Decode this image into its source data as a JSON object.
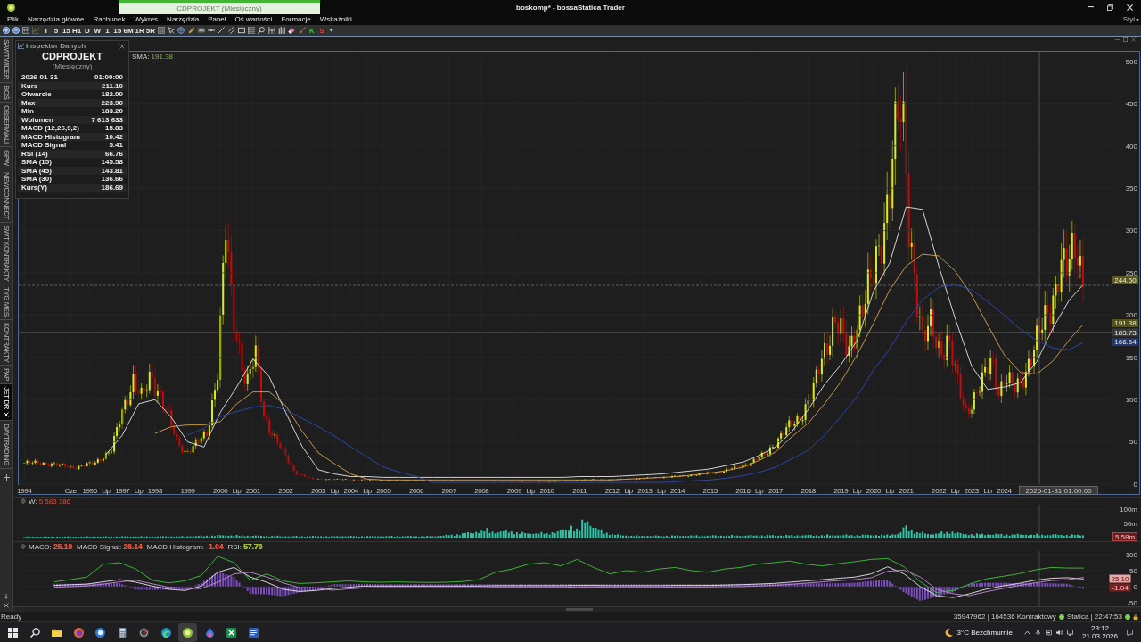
{
  "window": {
    "title": "boskomp* - bossaStatica Trader",
    "document_tab": "CDPROJEKT (Miesięczny)",
    "style_menu": "Styl"
  },
  "menu": [
    "Plik",
    "Narzędzia główne",
    "Rachunek",
    "Wykres",
    "Narzędzia",
    "Panel",
    "Oś wartości",
    "Formacje",
    "Wskaźniki"
  ],
  "toolbar": {
    "intervals": [
      "T",
      "5",
      "15",
      "H1",
      "D",
      "W",
      "1",
      "15",
      "6M",
      "1R",
      "5R"
    ],
    "k_button": "K",
    "s_button": "S"
  },
  "side_tabs": [
    {
      "label": "SAWTWIDER",
      "selected": false
    },
    {
      "label": "BOŚ",
      "selected": false
    },
    {
      "label": "OBSERWALI",
      "selected": false
    },
    {
      "label": "GPW",
      "selected": false
    },
    {
      "label": "NEWCONNECT",
      "selected": false
    },
    {
      "label": "SWT KONTRAKTY",
      "selected": false
    },
    {
      "label": "TYG MES",
      "selected": false
    },
    {
      "label": "KONTRAKTY",
      "selected": false
    },
    {
      "label": "PAP",
      "selected": false
    },
    {
      "label": "JET DR",
      "selected": true
    },
    {
      "label": "DAYTRADING",
      "selected": false
    }
  ],
  "inspector": {
    "title": "Inspektor Danych",
    "symbol": "CDPROJEKT",
    "interval": "(Miesięczny)",
    "rows": [
      {
        "label": "2026-01-31",
        "value": "01:00:00"
      },
      {
        "label": "Kurs",
        "value": "211.10"
      },
      {
        "label": "Otwarcie",
        "value": "182.00"
      },
      {
        "label": "Max",
        "value": "223.90"
      },
      {
        "label": "Min",
        "value": "183.20"
      },
      {
        "label": "Wolumen",
        "value": "7 613 633"
      },
      {
        "label": "MACD (12,26,9,2)",
        "value": "15.83"
      },
      {
        "label": "MACD Histogram",
        "value": "10.42"
      },
      {
        "label": "MACD Signal",
        "value": "5.41"
      },
      {
        "label": "RSI (14)",
        "value": "66.76"
      },
      {
        "label": "SMA (15)",
        "value": "145.58"
      },
      {
        "label": "SMA (45)",
        "value": "143.81"
      },
      {
        "label": "SMA (30)",
        "value": "136.66"
      },
      {
        "label": "Kurs(Y)",
        "value": "186.69"
      }
    ]
  },
  "price_chart": {
    "legend": {
      "label": "SMA:",
      "value": "191.38"
    },
    "crosshair_date": "2025-01-31 01:00:00",
    "markers": [
      {
        "text": "244.50",
        "color": "#5c5a1e"
      },
      {
        "text": "191.38",
        "color": "#55531c"
      },
      {
        "text": "183.73",
        "color": "#3a3a3a"
      },
      {
        "text": "166.54",
        "color": "#23366e"
      }
    ],
    "chart_data": {
      "type": "line",
      "grid": true,
      "x": [
        1996.5,
        1997,
        1997.5,
        1998,
        1998.5,
        1999,
        1999.5,
        2000,
        2000.5,
        2001,
        2001.5,
        2002,
        2002.5,
        2003,
        2003.5,
        2004,
        2004.5,
        2005,
        2005.5,
        2006,
        2006.5,
        2007,
        2007.5,
        2008,
        2008.5,
        2009,
        2009.5,
        2010,
        2010.5,
        2011,
        2011.5,
        2012,
        2012.5,
        2013,
        2013.5,
        2014,
        2014.5,
        2015,
        2015.5,
        2016,
        2016.5,
        2017,
        2017.5,
        2018,
        2018.5,
        2019,
        2019.5,
        2020,
        2020.5,
        2021,
        2021.5,
        2022,
        2022.5,
        2023,
        2023.5,
        2024,
        2024.5,
        2025,
        2025.5,
        2026,
        2026.4
      ],
      "series": [
        {
          "color": "#e6e6e6",
          "values": [
            35,
            58,
            95,
            100,
            79,
            50,
            44,
            85,
            115,
            148,
            127,
            85,
            45,
            17,
            12,
            9,
            9,
            8,
            8,
            8,
            8,
            8,
            8,
            8,
            8,
            8,
            8,
            8,
            8,
            9,
            9,
            9,
            10,
            11,
            12,
            14,
            16,
            18,
            22,
            26,
            34,
            44,
            62,
            88,
            118,
            141,
            170,
            228,
            262,
            328,
            325,
            258,
            196,
            140,
            112,
            115,
            120,
            145,
            185,
            218,
            235
          ]
        },
        {
          "color": "#d6a44c",
          "values": [
            null,
            null,
            null,
            60,
            68,
            70,
            70,
            74,
            95,
            109,
            109,
            93,
            63,
            37,
            24,
            12,
            6,
            5,
            5,
            5,
            5,
            5,
            5,
            5,
            5,
            5,
            5,
            5,
            5,
            5,
            5,
            5,
            6,
            7,
            8,
            9,
            11,
            13,
            16,
            20,
            28,
            38,
            56,
            72,
            95,
            121,
            153,
            190,
            230,
            258,
            272,
            270,
            252,
            224,
            188,
            153,
            132,
            130,
            146,
            171,
            188
          ]
        },
        {
          "color": "#2d4bb8",
          "values": [
            null,
            null,
            null,
            null,
            null,
            58,
            66,
            80,
            86,
            91,
            93,
            88,
            78,
            68,
            57,
            44,
            32,
            20,
            14,
            9,
            2,
            2,
            2,
            2,
            2,
            2,
            2,
            2,
            2,
            2,
            2,
            2,
            2,
            2,
            2,
            3,
            4,
            5,
            7,
            10,
            14,
            20,
            30,
            40,
            58,
            80,
            104,
            135,
            160,
            192,
            218,
            233,
            236,
            230,
            216,
            200,
            183,
            170,
            161,
            159,
            167
          ]
        }
      ],
      "xlim": [
        1993.8,
        2027.29
      ],
      "ylim": [
        0,
        512
      ],
      "xticks": [
        {
          "value": 1994,
          "label": "1994"
        },
        {
          "value": 1995.42,
          "label": "Cze"
        },
        {
          "value": 1996,
          "label": "1996"
        },
        {
          "value": 1996.5,
          "label": "Lip"
        },
        {
          "value": 1997,
          "label": "1997"
        },
        {
          "value": 1997.5,
          "label": "Lip"
        },
        {
          "value": 1998,
          "label": "1998"
        },
        {
          "value": 1999,
          "label": "1999"
        },
        {
          "value": 2000,
          "label": "2000"
        },
        {
          "value": 2000.5,
          "label": "Lip"
        },
        {
          "value": 2001,
          "label": "2001"
        },
        {
          "value": 2002,
          "label": "2002"
        },
        {
          "value": 2003,
          "label": "2003"
        },
        {
          "value": 2003.5,
          "label": "Lip"
        },
        {
          "value": 2004,
          "label": "2004"
        },
        {
          "value": 2004.5,
          "label": "Lip"
        },
        {
          "value": 2005,
          "label": "2005"
        },
        {
          "value": 2006,
          "label": "2006"
        },
        {
          "value": 2007,
          "label": "2007"
        },
        {
          "value": 2008,
          "label": "2008"
        },
        {
          "value": 2009,
          "label": "2009"
        },
        {
          "value": 2009.5,
          "label": "Lip"
        },
        {
          "value": 2010,
          "label": "2010"
        },
        {
          "value": 2011,
          "label": "2011"
        },
        {
          "value": 2012,
          "label": "2012"
        },
        {
          "value": 2012.5,
          "label": "Lip"
        },
        {
          "value": 2013,
          "label": "2013"
        },
        {
          "value": 2013.5,
          "label": "Lip"
        },
        {
          "value": 2014,
          "label": "2014"
        },
        {
          "value": 2015,
          "label": "2015"
        },
        {
          "value": 2016,
          "label": "2016"
        },
        {
          "value": 2016.5,
          "label": "Lip"
        },
        {
          "value": 2017,
          "label": "2017"
        },
        {
          "value": 2018,
          "label": "2018"
        },
        {
          "value": 2019,
          "label": "2019"
        },
        {
          "value": 2019.5,
          "label": "Lip"
        },
        {
          "value": 2020,
          "label": "2020"
        },
        {
          "value": 2020.5,
          "label": "Lip"
        },
        {
          "value": 2021,
          "label": "2021"
        },
        {
          "value": 2022,
          "label": "2022"
        },
        {
          "value": 2022.5,
          "label": "Lip"
        },
        {
          "value": 2023,
          "label": "2023"
        },
        {
          "value": 2023.5,
          "label": "Lip"
        },
        {
          "value": 2024,
          "label": "2024"
        }
      ],
      "yticks": [
        0,
        50,
        100,
        150,
        200,
        250,
        300,
        350,
        400,
        450,
        500
      ]
    }
  },
  "volume_panel": {
    "legend": {
      "label": "W:",
      "value": "5 583 386"
    },
    "y_labels": [
      "100m",
      "50m"
    ],
    "marker": "5.58m"
  },
  "macd_panel": {
    "legend": [
      {
        "label": "MACD:",
        "value": "25.10",
        "color": "#e0503c"
      },
      {
        "label": "MACD Signal:",
        "value": "26.14",
        "color": "#e0503c"
      },
      {
        "label": "MACD Histogram:",
        "value": "-1.04",
        "color": "#e0503c"
      },
      {
        "label": "RSI:",
        "value": "57.70",
        "color": "#a8c23c"
      }
    ],
    "markers": [
      {
        "text": "25.10",
        "color": "#e8a8a8"
      },
      {
        "text": "-1.04",
        "color": "#7a2020"
      }
    ],
    "chart_data": {
      "type": "line",
      "grid": true,
      "categories": [
        null,
        null,
        null,
        null,
        null,
        null,
        null,
        null,
        null,
        null,
        null,
        null,
        null,
        null,
        null,
        null,
        null,
        null,
        null,
        null,
        null,
        null,
        null,
        null,
        null,
        null,
        null,
        null,
        null,
        null,
        null,
        null,
        null,
        null,
        null,
        null,
        null,
        null,
        null,
        null,
        null,
        null,
        null,
        null,
        null,
        null,
        null,
        null,
        null,
        null,
        null,
        null,
        null,
        null,
        null,
        null,
        null,
        null,
        null,
        null,
        null,
        null,
        null,
        null,
        null,
        null,
        null,
        null,
        null
      ],
      "series": [
        {
          "color": "#e8e8e8",
          "values": [
            null,
            null,
            4,
            6,
            8,
            15,
            22,
            14,
            2,
            -8,
            -12,
            2,
            45,
            60,
            30,
            14,
            -8,
            -15,
            -12,
            -6,
            -2,
            2,
            2,
            2,
            2,
            2,
            2,
            2,
            2,
            3,
            3,
            3,
            3,
            3,
            4,
            4,
            3,
            3,
            3,
            3,
            4,
            4,
            4,
            5,
            6,
            8,
            10,
            14,
            18,
            22,
            26,
            30,
            40,
            62,
            40,
            0,
            -28,
            -34,
            -22,
            -8,
            2,
            10,
            20,
            26,
            28,
            24,
            null,
            null,
            null
          ]
        },
        {
          "color": "#c58ad8",
          "values": [
            null,
            null,
            -2,
            0,
            2,
            8,
            15,
            20,
            9,
            -2,
            -5,
            -6,
            14,
            40,
            45,
            30,
            12,
            -3,
            -4,
            -11,
            -7,
            -4,
            -3,
            -3,
            -3,
            -3,
            -3,
            -3,
            -3,
            -2,
            -2,
            -2,
            -2,
            -2,
            -1,
            -1,
            -2,
            -2,
            -2,
            -2,
            -1,
            -1,
            -1,
            0,
            0,
            2,
            4,
            7,
            11,
            15,
            19,
            22,
            28,
            48,
            52,
            30,
            -8,
            -22,
            -28,
            -16,
            -6,
            3,
            12,
            19,
            22,
            29,
            null,
            null,
            null
          ]
        },
        {
          "color": "#3fc43a",
          "values": [
            null,
            null,
            15,
            22,
            30,
            70,
            75,
            55,
            20,
            12,
            18,
            35,
            95,
            75,
            20,
            40,
            18,
            10,
            12,
            15,
            18,
            15,
            14,
            15,
            14,
            13,
            14,
            16,
            22,
            45,
            55,
            70,
            75,
            65,
            85,
            60,
            40,
            50,
            45,
            55,
            60,
            50,
            45,
            55,
            60,
            70,
            75,
            80,
            70,
            65,
            72,
            78,
            85,
            88,
            62,
            15,
            -18,
            -12,
            8,
            24,
            32,
            40,
            52,
            60,
            58,
            58,
            null,
            null,
            null
          ]
        }
      ],
      "ylim": [
        -77.8,
        100
      ],
      "yticks": [
        100,
        50,
        0,
        -50
      ]
    }
  },
  "status_bar": {
    "text": "Ready",
    "connection": "35947962 | 164536 Kontraktowy",
    "session": "Statica | 22:47:53"
  },
  "taskbar": {
    "apps": [
      {
        "selected": false
      },
      {
        "selected": false
      },
      {
        "selected": false
      },
      {
        "selected": false
      },
      {
        "selected": false
      },
      {
        "selected": false
      },
      {
        "selected": true
      },
      {
        "selected": false
      },
      {
        "selected": false
      },
      {
        "selected": false
      }
    ],
    "weather": "3°C Bezchmurnie",
    "time": "23:12",
    "date": "21.03.2026"
  }
}
